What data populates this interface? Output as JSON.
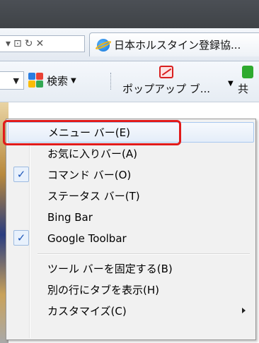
{
  "addressbar": {
    "controls": [
      "▾",
      "⊡",
      "↻",
      "✕"
    ],
    "tab_title": "日本ホルスタイン登録協..."
  },
  "commandbar": {
    "search_label": "検索",
    "popup_label": "ポップアップ ブ...",
    "share_label": "共"
  },
  "menu": {
    "items": [
      {
        "label": "メニュー バー(E)",
        "checked": false,
        "highlighted": true
      },
      {
        "label": "お気に入りバー(A)",
        "checked": false
      },
      {
        "label": "コマンド バー(O)",
        "checked": true
      },
      {
        "label": "ステータス バー(T)",
        "checked": false
      },
      {
        "label": "Bing Bar",
        "checked": false
      },
      {
        "label": "Google Toolbar",
        "checked": true
      },
      {
        "label": "ツール バーを固定する(B)",
        "checked": false
      },
      {
        "label": "別の行にタブを表示(H)",
        "checked": false
      },
      {
        "label": "カスタマイズ(C)",
        "checked": false,
        "submenu": true
      }
    ],
    "check_glyph": "✓"
  },
  "colors": {
    "highlight_box": "#e11a1a",
    "check": "#1d56b8"
  }
}
